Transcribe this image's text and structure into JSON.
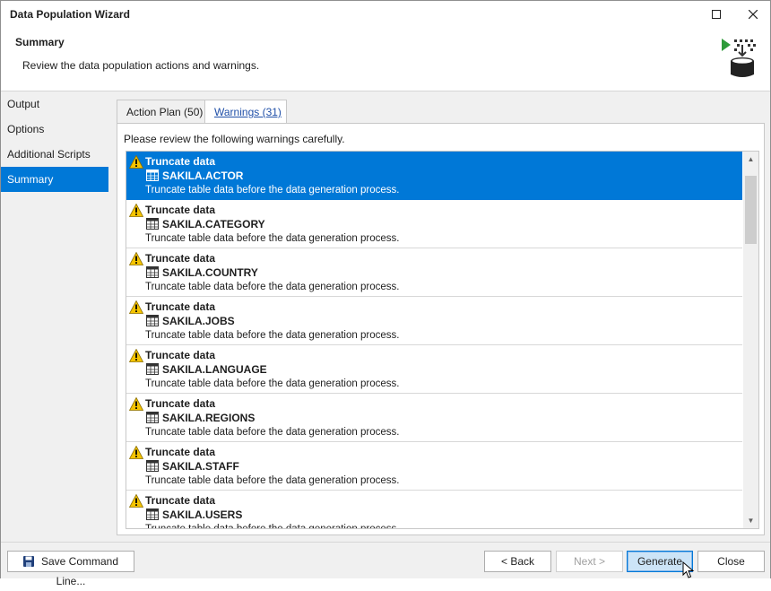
{
  "window": {
    "title": "Data Population Wizard",
    "maximize_icon": "maximize-icon",
    "close_icon": "close-icon"
  },
  "header": {
    "title": "Summary",
    "subtitle": "Review the data population actions and warnings.",
    "icon": "data-generation-icon"
  },
  "sidebar": {
    "items": [
      {
        "label": "Output",
        "active": false
      },
      {
        "label": "Options",
        "active": false
      },
      {
        "label": "Additional Scripts",
        "active": false
      },
      {
        "label": "Summary",
        "active": true
      }
    ]
  },
  "tabs": [
    {
      "label": "Action Plan (50)",
      "active": false
    },
    {
      "label": "Warnings (31)",
      "active": true
    }
  ],
  "warnings": {
    "note": "Please review the following warnings carefully.",
    "items": [
      {
        "title": "Truncate data",
        "table": "SAKILA.ACTOR",
        "description": "Truncate table data before the data generation process.",
        "selected": true
      },
      {
        "title": "Truncate data",
        "table": "SAKILA.CATEGORY",
        "description": "Truncate table data before the data generation process.",
        "selected": false
      },
      {
        "title": "Truncate data",
        "table": "SAKILA.COUNTRY",
        "description": "Truncate table data before the data generation process.",
        "selected": false
      },
      {
        "title": "Truncate data",
        "table": "SAKILA.JOBS",
        "description": "Truncate table data before the data generation process.",
        "selected": false
      },
      {
        "title": "Truncate data",
        "table": "SAKILA.LANGUAGE",
        "description": "Truncate table data before the data generation process.",
        "selected": false
      },
      {
        "title": "Truncate data",
        "table": "SAKILA.REGIONS",
        "description": "Truncate table data before the data generation process.",
        "selected": false
      },
      {
        "title": "Truncate data",
        "table": "SAKILA.STAFF",
        "description": "Truncate table data before the data generation process.",
        "selected": false
      },
      {
        "title": "Truncate data",
        "table": "SAKILA.USERS",
        "description": "Truncate table data before the data generation process.",
        "selected": false
      }
    ]
  },
  "footer": {
    "save_label": "Save Command Line...",
    "back_label": "< Back",
    "next_label": "Next >",
    "generate_label": "Generate",
    "close_label": "Close"
  },
  "colors": {
    "accent": "#0078d7",
    "warning": "#f5c400",
    "success_arrow": "#2e9b3a"
  }
}
